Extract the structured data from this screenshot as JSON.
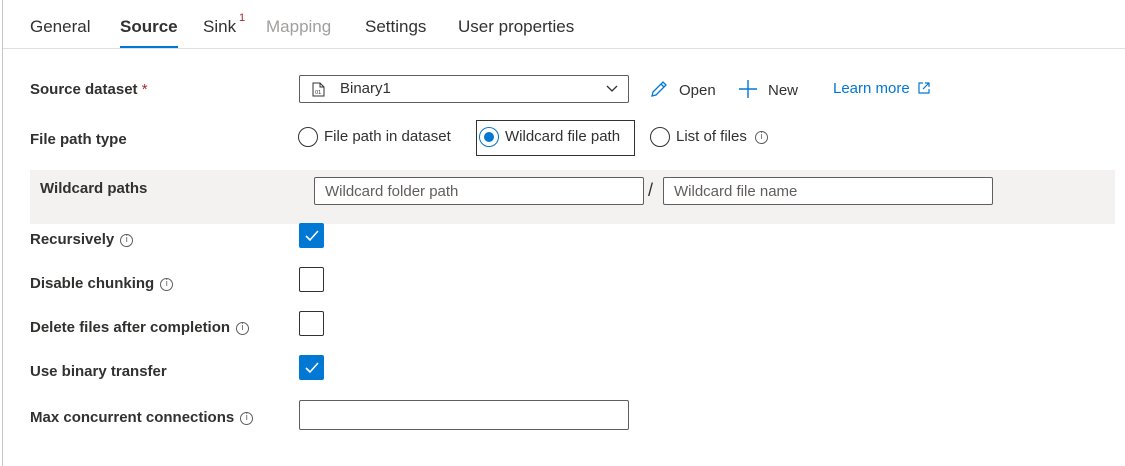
{
  "tabs": [
    {
      "label": "General",
      "state": "normal"
    },
    {
      "label": "Source",
      "state": "active"
    },
    {
      "label": "Sink",
      "state": "normal",
      "badge": "1"
    },
    {
      "label": "Mapping",
      "state": "disabled"
    },
    {
      "label": "Settings",
      "state": "normal"
    },
    {
      "label": "User properties",
      "state": "normal"
    }
  ],
  "source_dataset": {
    "label": "Source dataset",
    "required_mark": "*",
    "value": "Binary1",
    "open_label": "Open",
    "new_label": "New",
    "learn_more_label": "Learn more"
  },
  "file_path_type": {
    "label": "File path type",
    "options": [
      "File path in dataset",
      "Wildcard file path",
      "List of files"
    ],
    "selected": "Wildcard file path"
  },
  "wildcard_paths": {
    "label": "Wildcard paths",
    "folder_placeholder": "Wildcard folder path",
    "separator": "/",
    "file_placeholder": "Wildcard file name"
  },
  "options": {
    "recursively": {
      "label": "Recursively",
      "checked": true
    },
    "disable_chunking": {
      "label": "Disable chunking",
      "checked": false
    },
    "delete_files": {
      "label": "Delete files after completion",
      "checked": false
    },
    "binary_transfer": {
      "label": "Use binary transfer",
      "checked": true
    }
  },
  "max_connections": {
    "label": "Max concurrent connections",
    "value": ""
  },
  "colors": {
    "accent": "#0078d4",
    "required": "#a4262c",
    "panel": "#f3f2f1"
  }
}
